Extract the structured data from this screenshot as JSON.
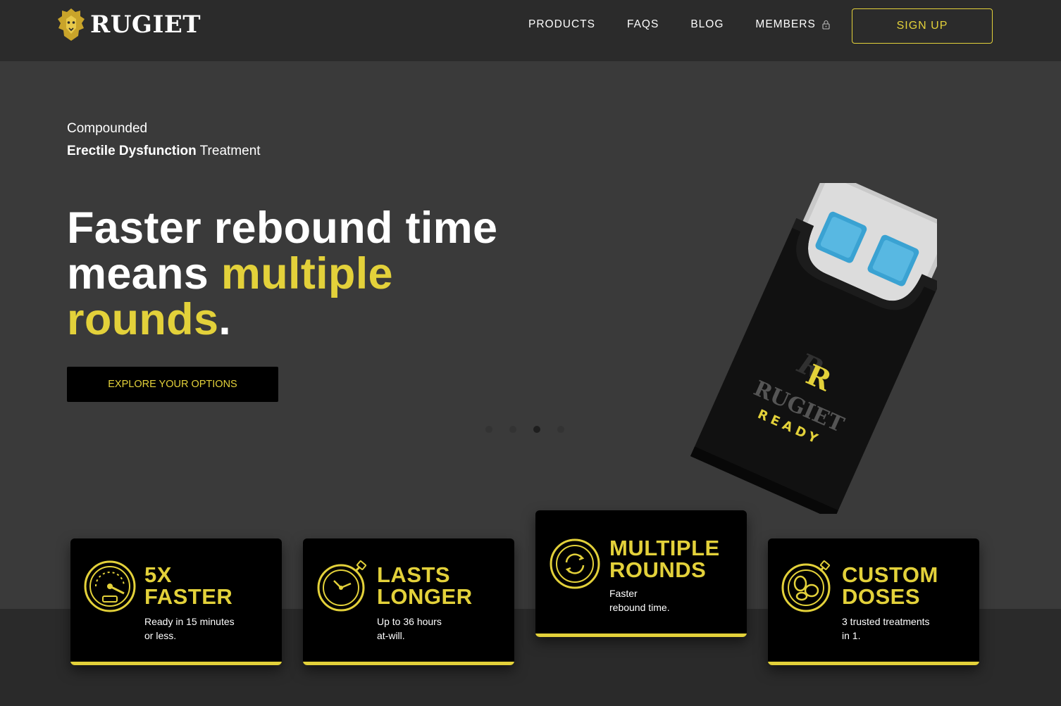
{
  "brand": {
    "name": "RUGIET",
    "accent": "#e3d13a"
  },
  "nav": {
    "products": "PRODUCTS",
    "faqs": "FAQS",
    "blog": "BLOG",
    "members": "MEMBERS"
  },
  "signup": "SIGN UP",
  "hero": {
    "eyebrow_line1": "Compounded",
    "eyebrow_bold": "Erectile Dysfunction",
    "eyebrow_rest": " Treatment",
    "headline_white1": "Faster rebound time",
    "headline_white2": "means ",
    "headline_yellow1": "multiple",
    "headline_yellow2": "rounds",
    "headline_end": ".",
    "cta": "EXPLORE YOUR OPTIONS",
    "slides": 4,
    "active_slide": 3
  },
  "product": {
    "brand": "RUGIET",
    "sub": "READY"
  },
  "features": [
    {
      "title1": "5X",
      "title2": "FASTER",
      "desc1": "Ready in 15 minutes",
      "desc2": "or less.",
      "icon": "speedometer-icon"
    },
    {
      "title1": "LASTS",
      "title2": "LONGER",
      "desc1": "Up to 36 hours",
      "desc2": "at-will.",
      "icon": "stopwatch-icon"
    },
    {
      "title1": "MULTIPLE",
      "title2": "ROUNDS",
      "desc1": "Faster",
      "desc2": "rebound time.",
      "icon": "cycle-icon"
    },
    {
      "title1": "CUSTOM",
      "title2": "DOSES",
      "desc1": "3 trusted treatments",
      "desc2": "in 1.",
      "icon": "pill-flask-icon"
    }
  ]
}
